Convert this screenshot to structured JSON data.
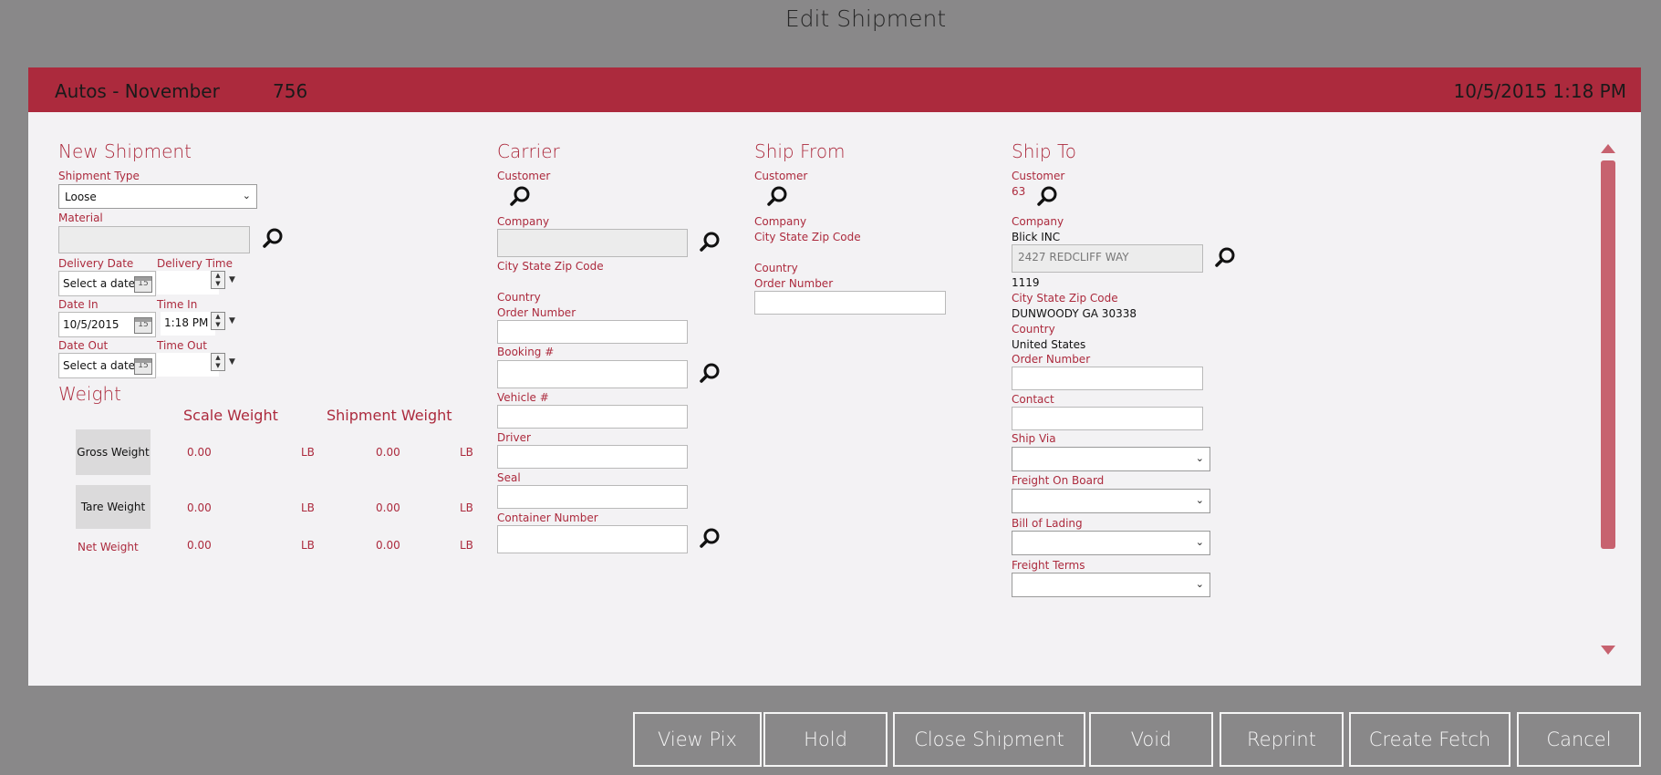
{
  "window": {
    "title": "Edit Shipment"
  },
  "header": {
    "title": "Autos - November",
    "number": "756",
    "datetime": "10/5/2015 1:18 PM"
  },
  "new_shipment": {
    "title": "New Shipment",
    "shipment_type_label": "Shipment Type",
    "shipment_type_value": "Loose",
    "material_label": "Material",
    "delivery_date_label": "Delivery Date",
    "delivery_time_label": "Delivery Time",
    "delivery_date_value": "Select a date",
    "date_in_label": "Date In",
    "time_in_label": "Time In",
    "date_in_value": "10/5/2015",
    "time_in_value": "1:18 PM",
    "date_out_label": "Date Out",
    "time_out_label": "Time Out",
    "date_out_value": "Select a date",
    "calendar_glyph": "15"
  },
  "weight": {
    "title": "Weight",
    "scale_weight_label": "Scale Weight",
    "shipment_weight_label": "Shipment Weight",
    "rows": [
      {
        "label": "Gross Weight",
        "scale": "0.00",
        "scale_unit": "LB",
        "shipment": "0.00",
        "shipment_unit": "LB"
      },
      {
        "label": "Tare Weight",
        "scale": "0.00",
        "scale_unit": "LB",
        "shipment": "0.00",
        "shipment_unit": "LB"
      },
      {
        "label": "Net Weight",
        "scale": "0.00",
        "scale_unit": "LB",
        "shipment": "0.00",
        "shipment_unit": "LB"
      }
    ]
  },
  "carrier": {
    "title": "Carrier",
    "customer_label": "Customer",
    "company_label": "Company",
    "city_label": "City State Zip Code",
    "country_label": "Country",
    "order_number_label": "Order Number",
    "booking_label": "Booking #",
    "vehicle_label": "Vehicle #",
    "driver_label": "Driver",
    "seal_label": "Seal",
    "container_label": "Container Number"
  },
  "ship_from": {
    "title": "Ship From",
    "customer_label": "Customer",
    "company_label": "Company",
    "city_label": "City State Zip Code",
    "country_label": "Country",
    "order_number_label": "Order Number"
  },
  "ship_to": {
    "title": "Ship To",
    "customer_label": "Customer",
    "customer_value": "63",
    "company_label": "Company",
    "company_value": "Blick INC",
    "address_value": "2427 REDCLIFF WAY",
    "address2_value": "1119",
    "city_label": "City State Zip Code",
    "city_value": "DUNWOODY GA 30338",
    "country_label": "Country",
    "country_value": "United States",
    "order_number_label": "Order Number",
    "contact_label": "Contact",
    "ship_via_label": "Ship Via",
    "fob_label": "Freight On Board",
    "bol_label": "Bill of Lading",
    "terms_label": "Freight Terms"
  },
  "footer": {
    "view_pix": "View Pix",
    "hold": "Hold",
    "close_shipment": "Close Shipment",
    "void": "Void",
    "reprint": "Reprint",
    "create_fetch": "Create Fetch",
    "cancel": "Cancel"
  },
  "colors": {
    "accent": "#ac2a3d",
    "background": "#898889",
    "panel": "#f3f2f4"
  }
}
